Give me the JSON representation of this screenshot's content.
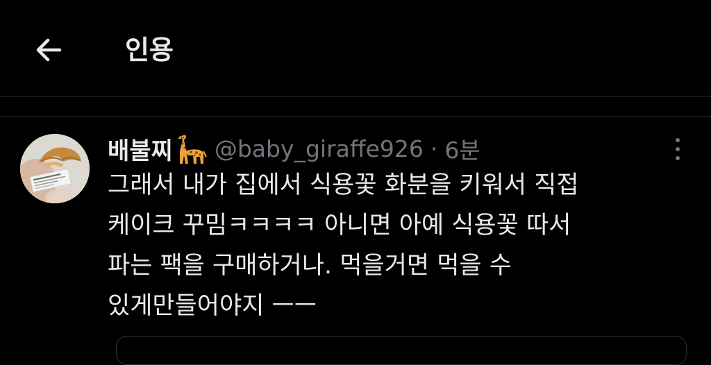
{
  "header": {
    "title": "인용"
  },
  "tweet": {
    "display_name": "배불찌",
    "handle": "@baby_giraffe926",
    "separator": "·",
    "time": "6분",
    "lines": [
      "그래서 내가 집에서 식용꽃 화분을 키워서 직접",
      "케이크 꾸밈ㅋㅋㅋㅋ 아니면 아예 식용꽃 따서",
      "파는 팩을 구매하거나. 먹을거면 먹을 수",
      "있게만들어야지 ㅡㅡ"
    ]
  },
  "colors": {
    "background": "#000000",
    "text_primary": "#e7e9ea",
    "text_secondary": "#71767b",
    "divider": "#2f3336"
  },
  "icons": {
    "back": "arrow-left-icon",
    "more": "more-vertical-icon",
    "emoji": "giraffe-emoji"
  }
}
